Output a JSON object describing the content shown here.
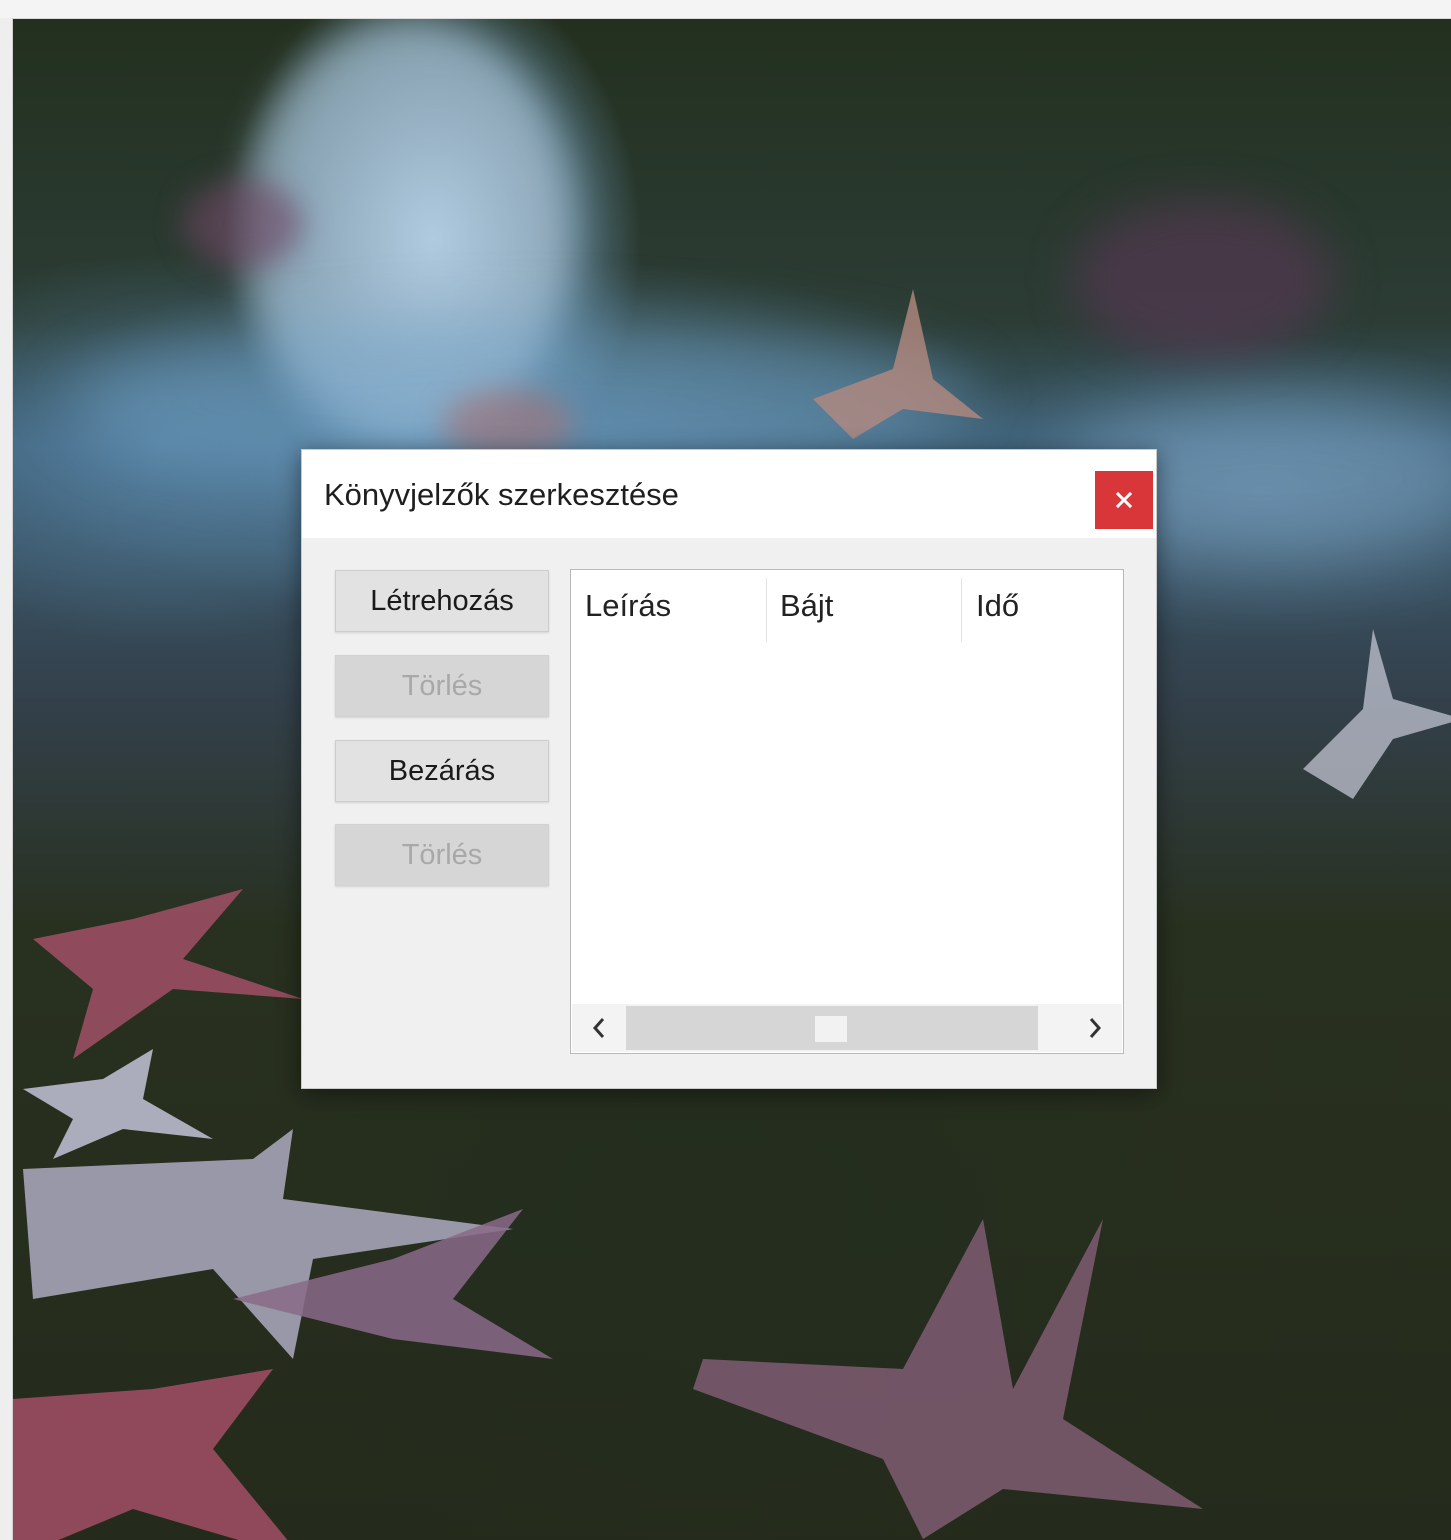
{
  "dialog": {
    "title": "Könyvjelzők szerkesztése",
    "close_icon": "close-icon",
    "buttons": {
      "create": "Létrehozás",
      "delete_1": "Törlés",
      "close": "Bezárás",
      "delete_2": "Törlés"
    },
    "list": {
      "columns": [
        "Leírás",
        "Bájt",
        "Idő"
      ],
      "rows": []
    },
    "scrollbar": {
      "left_icon": "chevron-left-icon",
      "right_icon": "chevron-right-icon"
    }
  },
  "colors": {
    "close_button": "#d9363a",
    "dialog_bg": "#f0f0f0",
    "titlebar_bg": "#ffffff"
  }
}
